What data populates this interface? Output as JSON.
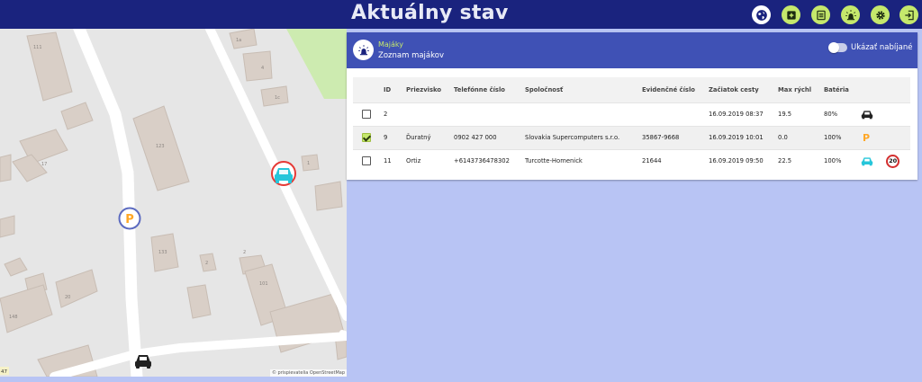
{
  "header": {
    "title": "Aktuálny stav"
  },
  "toolbar": {
    "colors": {
      "globe": "#ffffff",
      "lime": "#c5e86c",
      "bar": "#1a237e"
    },
    "buttons": [
      "globe-icon",
      "add-box-icon",
      "list-icon",
      "beacon-icon",
      "settings-icon",
      "logout-icon"
    ]
  },
  "map": {
    "attribution": "© prispievatelia OpenStreetMap",
    "edge_label": "47",
    "building_labels": [
      "111",
      "1a",
      "4",
      "1c",
      "17",
      "1",
      "123",
      "133",
      "2",
      "2",
      "101",
      "148",
      "20"
    ],
    "markers": [
      {
        "name": "parking-marker",
        "label": "P",
        "ring": "#5c6bc0",
        "fill": "#ffa726"
      },
      {
        "name": "car-marker-speeding",
        "ring": "#e53935",
        "fill": "#26c6da"
      },
      {
        "name": "car-marker",
        "fill": "#222222"
      }
    ]
  },
  "panel": {
    "title": "Majáky",
    "subtitle": "Zoznam majákov",
    "toggle_label": "Ukázať nabíjané",
    "columns": [
      "ID",
      "Priezvisko",
      "Telefónne číslo",
      "Spoločnosť",
      "Evidenčné číslo",
      "Začiatok cesty",
      "Max rýchl",
      "Batéria"
    ],
    "rows": [
      {
        "checked": false,
        "id": "2",
        "surname": "",
        "phone": "",
        "company": "",
        "reg": "",
        "start": "16.09.2019 08:37",
        "speed": "19.5",
        "battery": "80%",
        "status_icon": "car-icon",
        "status_color": "#222222",
        "badge": ""
      },
      {
        "checked": true,
        "id": "9",
        "surname": "Ďuratný",
        "phone": "0902 427 000",
        "company": "Slovakia Supercomputers s.r.o.",
        "reg": "35867-9668",
        "start": "16.09.2019 10:01",
        "speed": "0.0",
        "battery": "100%",
        "status_icon": "parking-icon",
        "status_color": "#ffa726",
        "badge": ""
      },
      {
        "checked": false,
        "id": "11",
        "surname": "Ortiz",
        "phone": "+6143736478302",
        "company": "Turcotte-Homenick",
        "reg": "21644",
        "start": "16.09.2019 09:50",
        "speed": "22.5",
        "battery": "100%",
        "status_icon": "car-icon",
        "status_color": "#26c6da",
        "badge": "20"
      }
    ]
  }
}
